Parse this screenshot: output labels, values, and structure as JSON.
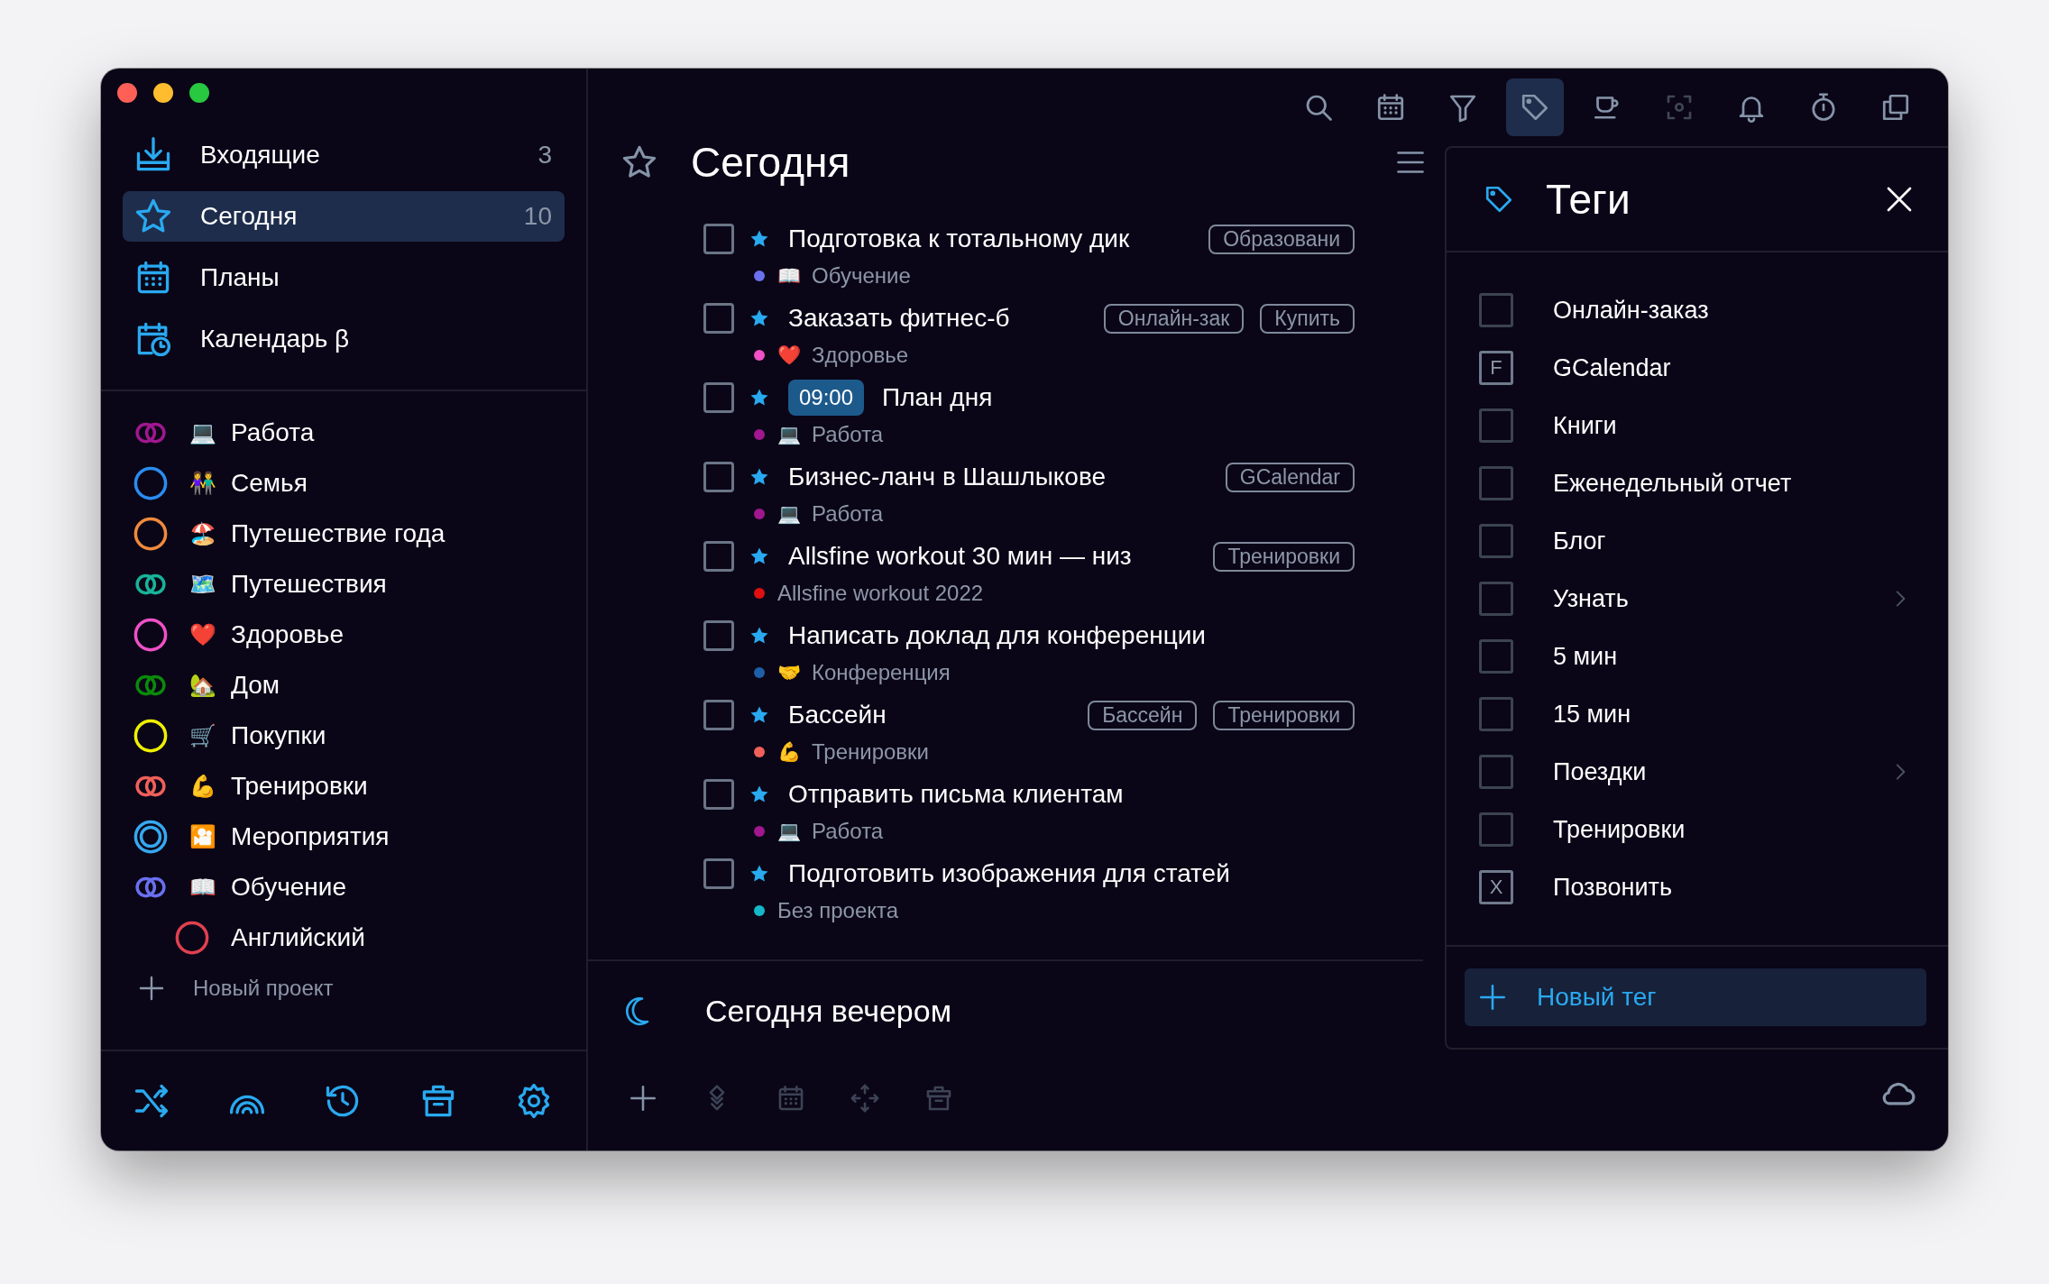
{
  "window": {
    "controls": [
      {
        "kind": "close"
      },
      {
        "kind": "minimize"
      },
      {
        "kind": "zoom"
      }
    ]
  },
  "sidebar": {
    "nav": [
      {
        "label": "Входящие",
        "count": "3",
        "kind": "inbox",
        "selected": false
      },
      {
        "label": "Сегодня",
        "count": "10",
        "kind": "star",
        "selected": true
      },
      {
        "label": "Планы",
        "kind": "calendar",
        "selected": false
      },
      {
        "label": "Календарь β",
        "kind": "calendar-clock",
        "selected": false
      }
    ],
    "projects": [
      {
        "name": "Работа",
        "emoji": "💻",
        "kind": "double",
        "color": "#a0178f"
      },
      {
        "name": "Семья",
        "emoji": "👫",
        "kind": "ring",
        "color": "#2a8cf0"
      },
      {
        "name": "Путешествие года",
        "emoji": "🏖",
        "kind": "ring",
        "color": "#f08a3c"
      },
      {
        "name": "Путешествия",
        "emoji": "🗺",
        "kind": "double",
        "color": "#18b39a"
      },
      {
        "name": "Здоровье",
        "emoji": "❤️",
        "kind": "ring",
        "color": "#f050c8"
      },
      {
        "name": "Дом",
        "emoji": "🏡",
        "kind": "double",
        "color": "#0a8a0a"
      },
      {
        "name": "Покупки",
        "emoji": "🛒",
        "kind": "ring",
        "color": "#f0f000"
      },
      {
        "name": "Тренировки",
        "emoji": "💪",
        "kind": "double",
        "color": "#f0605a"
      },
      {
        "name": "Мероприятия",
        "emoji": "🎦",
        "kind": "target",
        "color": "#36a8f0"
      },
      {
        "name": "Обучение",
        "emoji": "📖",
        "kind": "double",
        "color": "#6a70f0",
        "children": [
          {
            "name": "Английский",
            "kind": "ring",
            "color": "#e04050"
          }
        ]
      }
    ],
    "new_project": "Новый проект",
    "footer": [
      {
        "kind": "shuffle"
      },
      {
        "kind": "arches"
      },
      {
        "kind": "history"
      },
      {
        "kind": "archive"
      },
      {
        "kind": "settings"
      }
    ]
  },
  "toolbar": [
    {
      "kind": "search",
      "selected": false,
      "disabled": false
    },
    {
      "kind": "calendar",
      "selected": false,
      "disabled": false
    },
    {
      "kind": "filter",
      "selected": false,
      "disabled": false
    },
    {
      "kind": "tag",
      "selected": true,
      "disabled": false
    },
    {
      "kind": "cup",
      "selected": false,
      "disabled": false
    },
    {
      "kind": "focus",
      "selected": false,
      "disabled": true
    },
    {
      "kind": "bell",
      "selected": false,
      "disabled": false
    },
    {
      "kind": "stopwatch",
      "selected": false,
      "disabled": false
    },
    {
      "kind": "copy",
      "selected": false,
      "disabled": false
    }
  ],
  "main": {
    "title": "Сегодня",
    "tasks": [
      {
        "title": "Подготовка к тотальному дик",
        "checked": false,
        "starred": true,
        "tags": [
          "Образовани"
        ],
        "project": {
          "emoji": "📖",
          "name": "Обучение",
          "color": "#6a70f0"
        }
      },
      {
        "title": "Заказать фитнес-б",
        "checked": false,
        "starred": true,
        "tags": [
          "Онлайн-зак",
          "Купить"
        ],
        "project": {
          "emoji": "❤️",
          "name": "Здоровье",
          "color": "#f050c8"
        }
      },
      {
        "title": "План дня",
        "time": "09:00",
        "checked": false,
        "starred": true,
        "project": {
          "emoji": "💻",
          "name": "Работа",
          "color": "#a0178f"
        }
      },
      {
        "title": "Бизнес-ланч в Шашлыкове",
        "checked": false,
        "starred": true,
        "tags": [
          "GCalendar"
        ],
        "project": {
          "emoji": "💻",
          "name": "Работа",
          "color": "#a0178f"
        }
      },
      {
        "title": "Allsfine workout 30 мин — низ",
        "checked": false,
        "starred": true,
        "tags": [
          "Тренировки"
        ],
        "project": {
          "name": "Allsfine workout 2022",
          "color": "#e01010"
        }
      },
      {
        "title": "Написать доклад для конференции",
        "checked": false,
        "starred": true,
        "project": {
          "emoji": "🤝",
          "name": "Конференция",
          "color": "#1d5fa8"
        }
      },
      {
        "title": "Бассейн",
        "checked": false,
        "starred": true,
        "tags": [
          "Бассейн",
          "Тренировки"
        ],
        "project": {
          "emoji": "💪",
          "name": "Тренировки",
          "color": "#f0605a"
        }
      },
      {
        "title": "Отправить письма клиентам",
        "checked": false,
        "starred": true,
        "project": {
          "emoji": "💻",
          "name": "Работа",
          "color": "#a0178f"
        }
      },
      {
        "title": "Подготовить изображения для статей",
        "checked": false,
        "starred": true,
        "project": {
          "name": "Без проекта",
          "color": "#14b8c8"
        }
      }
    ],
    "evening": "Сегодня вечером",
    "footer": [
      {
        "kind": "plus"
      },
      {
        "kind": "layers"
      },
      {
        "kind": "calendar"
      },
      {
        "kind": "move"
      },
      {
        "kind": "archive"
      }
    ]
  },
  "tags_panel": {
    "title": "Теги",
    "tags": [
      {
        "label": "Онлайн-заказ",
        "checked": false,
        "has_submenu": false
      },
      {
        "label": "GCalendar",
        "key": "F",
        "checked": false,
        "has_submenu": false
      },
      {
        "label": "Книги",
        "checked": false,
        "has_submenu": false
      },
      {
        "label": "Еженедельный отчет",
        "checked": false,
        "has_submenu": false
      },
      {
        "label": "Блог",
        "checked": false,
        "has_submenu": false
      },
      {
        "label": "Узнать",
        "checked": false,
        "has_submenu": true
      },
      {
        "label": "5 мин",
        "checked": false,
        "has_submenu": false
      },
      {
        "label": "15 мин",
        "checked": false,
        "has_submenu": false
      },
      {
        "label": "Поездки",
        "checked": false,
        "has_submenu": true
      },
      {
        "label": "Тренировки",
        "checked": false,
        "has_submenu": false
      },
      {
        "label": "Позвонить",
        "key": "X",
        "checked": false,
        "has_submenu": false
      }
    ],
    "new_tag": "Новый тег"
  }
}
